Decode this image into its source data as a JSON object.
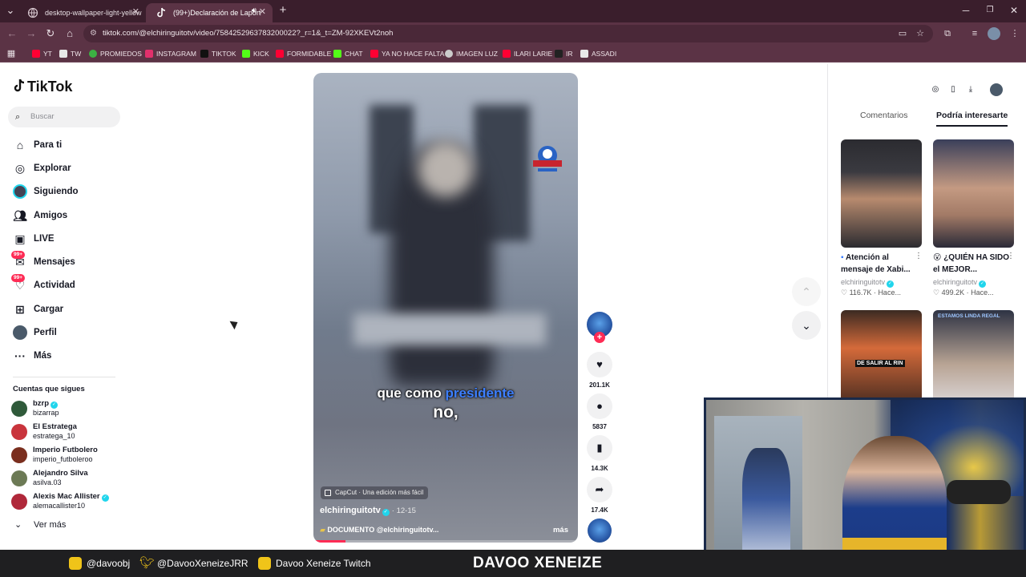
{
  "browser": {
    "tabs": [
      {
        "label": "desktop-wallpaper-light-yellow",
        "active": false
      },
      {
        "label": "(99+)Declaración de Laport",
        "active": true
      }
    ],
    "url": "tiktok.com/@elchiringuitotv/video/7584252963783200022?_r=1&_t=ZM-92XKEVt2noh",
    "bookmarks": [
      {
        "label": "YT",
        "color": "#ff0033"
      },
      {
        "label": "TW",
        "color": "#e8e8e8"
      },
      {
        "label": "PROMIEDOS",
        "color": "#3cb043"
      },
      {
        "label": "INSTAGRAM",
        "color": "#e1306c"
      },
      {
        "label": "TIKTOK",
        "color": "#111111"
      },
      {
        "label": "KICK",
        "color": "#53fc18"
      },
      {
        "label": "FORMIDABLE",
        "color": "#ff0033"
      },
      {
        "label": "CHAT",
        "color": "#53fc18"
      },
      {
        "label": "YA NO HACE FALTA",
        "color": "#ff0033"
      },
      {
        "label": "IMAGEN LUZ",
        "color": "#cccccc"
      },
      {
        "label": "ILARI LARIE",
        "color": "#ff0033"
      },
      {
        "label": "IR",
        "color": "#222222"
      },
      {
        "label": "ASSADI",
        "color": "#e8e8e8"
      }
    ]
  },
  "tiktok": {
    "logo": "TikTok",
    "search_placeholder": "Buscar",
    "nav": [
      {
        "label": "Para ti",
        "icon": "home-icon"
      },
      {
        "label": "Explorar",
        "icon": "compass-icon"
      },
      {
        "label": "Siguiendo",
        "icon": "following-avatar-icon"
      },
      {
        "label": "Amigos",
        "icon": "friends-icon"
      },
      {
        "label": "LIVE",
        "icon": "live-icon"
      },
      {
        "label": "Mensajes",
        "icon": "messages-icon",
        "badge": "99+"
      },
      {
        "label": "Actividad",
        "icon": "activity-icon",
        "badge": "99+"
      },
      {
        "label": "Cargar",
        "icon": "upload-icon"
      },
      {
        "label": "Perfil",
        "icon": "profile-icon"
      },
      {
        "label": "Más",
        "icon": "more-icon"
      }
    ],
    "following_title": "Cuentas que sigues",
    "following": [
      {
        "name": "bzrp",
        "user": "bizarrap",
        "verified": true,
        "color": "#2f5a3a"
      },
      {
        "name": "El Estratega",
        "user": "estratega_10",
        "verified": false,
        "color": "#c9343c"
      },
      {
        "name": "Imperio Futbolero",
        "user": "imperio_futboleroo",
        "verified": false,
        "color": "#7a2e1e"
      },
      {
        "name": "Alejandro Silva",
        "user": "asilva.03",
        "verified": false,
        "color": "#6c7a55"
      },
      {
        "name": "Alexis Mac Allister",
        "user": "alemacallister10",
        "verified": true,
        "color": "#b0283a"
      }
    ],
    "ver_mas": "Ver más"
  },
  "video": {
    "caption_line1_a": "que como",
    "caption_line1_b": "presidente",
    "caption_line2": "no,",
    "capcut": "CapCut · Una edición más fácil",
    "author": "elchiringuitotv",
    "date": "· 12-15",
    "description": "DOCUMENTO @elchiringuitotv...",
    "more": "más",
    "progress": 0.12,
    "likes": "201.1K",
    "comments": "5837",
    "saves": "14.3K",
    "shares": "17.4K"
  },
  "right_panel": {
    "tabs": [
      "Comentarios",
      "Podría interesarte"
    ],
    "active_tab": 1,
    "cards": [
      {
        "title": "Atención al mensaje de Xabi...",
        "author": "elchiringuitotv",
        "likes": "116.7K",
        "time": "Hace...",
        "colors": [
          "#2b2b30",
          "#b78a6e"
        ]
      },
      {
        "title": "😮 ¿QUIÉN HA SIDO el MEJOR...",
        "author": "elchiringuitotv",
        "likes": "499.2K",
        "time": "Hace...",
        "colors": [
          "#3a3f5a",
          "#c49a82"
        ]
      },
      {
        "title": "",
        "author": "",
        "likes": "",
        "time": "",
        "colors": [
          "#3b2a22",
          "#d46a3a"
        ],
        "overlay": "DE SALIR AL RIN"
      },
      {
        "title": "",
        "author": "",
        "likes": "",
        "time": "",
        "colors": [
          "#2e3344",
          "#b8a494"
        ],
        "overlay": "ESTAMOS LINDA REGAL"
      }
    ]
  },
  "stream_footer": {
    "instagram": "@davoobj",
    "twitter": "@DavooXeneizeJRR",
    "twitch": "Davoo Xeneize Twitch",
    "brand": "DAVOO XENEIZE"
  }
}
